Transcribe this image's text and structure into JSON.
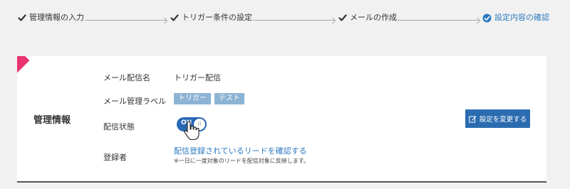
{
  "stepper": {
    "steps": [
      {
        "label": "管理情報の入力",
        "state": "done"
      },
      {
        "label": "トリガー条件の設定",
        "state": "done"
      },
      {
        "label": "メールの作成",
        "state": "done"
      },
      {
        "label": "設定内容の確認",
        "state": "active"
      }
    ]
  },
  "section": {
    "title": "管理情報",
    "edit_button_label": "設定を変更する"
  },
  "rows": {
    "mail_name_label": "メール配信名",
    "mail_name_value": "トリガー配信",
    "mail_label_label": "メール管理ラベル",
    "mail_tags": [
      "トリガー",
      "テスト"
    ],
    "status_label": "配信状態",
    "status_toggle": {
      "text": "ON",
      "state": "on",
      "knob_text": "II"
    },
    "registrant_label": "登録者",
    "registrant_link": "配信登録されているリードを確認する",
    "registrant_note": "※一日に一度対象のリードを配信対象に反映します。"
  },
  "colors": {
    "accent": "#2e7bbf",
    "button": "#2b6cb0",
    "toggle": "#2767b4",
    "tag": "#8cb3d4",
    "ribbon": "#e9336f"
  },
  "icons": {
    "done_step": "check-icon",
    "active_step": "check-circle-icon",
    "edit_button": "edit-icon",
    "pointer": "hand-cursor-icon"
  }
}
